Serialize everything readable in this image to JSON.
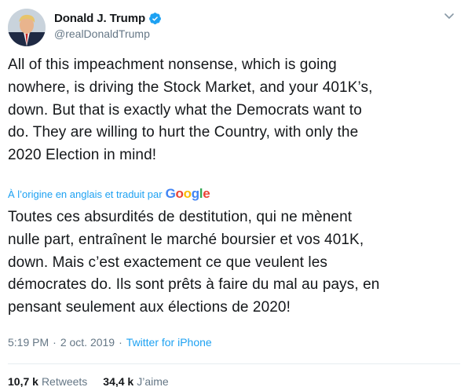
{
  "author": {
    "display_name": "Donald J. Trump",
    "handle": "@realDonaldTrump",
    "verified": true,
    "avatar_icon": "avatar-portrait",
    "verified_icon": "verified-badge-icon"
  },
  "tweet": {
    "text": "All of this impeachment nonsense, which is going\nnowhere, is driving the Stock Market, and your 401K’s,\ndown. But that is exactly what the Democrats want to\ndo. They are willing to hurt the Country, with only the\n2020 Election in mind!"
  },
  "translation": {
    "note": "À l’origine en anglais et traduit par",
    "provider": "Google",
    "text": "Toutes ces absurdités de destitution, qui ne mènent\nnulle part, entraînent le marché boursier et vos 401K,\ndown. Mais c’est exactement ce que veulent les\ndémocrates do. Ils sont prêts à faire du mal au pays, en\npensant seulement aux élections de 2020!"
  },
  "meta": {
    "time": "5:19 PM",
    "date": "2 oct. 2019",
    "separator": "·",
    "source": "Twitter for iPhone"
  },
  "stats": {
    "retweets_count": "10,7 k",
    "retweets_label": "Retweets",
    "likes_count": "34,4 k",
    "likes_label": "J’aime"
  },
  "colors": {
    "link_blue": "#1da1f2",
    "text_primary": "#14171a",
    "text_secondary": "#657786",
    "divider": "#e6ecf0"
  }
}
